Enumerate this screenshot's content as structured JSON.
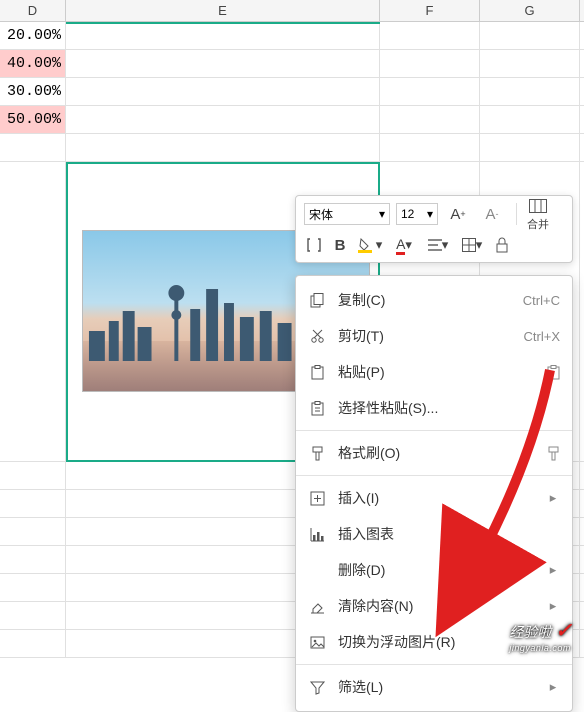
{
  "columns": {
    "d": "D",
    "e": "E",
    "f": "F",
    "g": "G"
  },
  "cells": {
    "d1": "20.00%",
    "d2": "40.00%",
    "d3": "30.00%",
    "d4": "50.00%"
  },
  "toolbar": {
    "font_name": "宋体",
    "font_size": "12",
    "increase_font": "A⁺",
    "decrease_font": "A⁻",
    "merge_label": "合并"
  },
  "menu": {
    "copy": {
      "label": "复制(C)",
      "shortcut": "Ctrl+C"
    },
    "cut": {
      "label": "剪切(T)",
      "shortcut": "Ctrl+X"
    },
    "paste": {
      "label": "粘贴(P)"
    },
    "paste_special": {
      "label": "选择性粘贴(S)..."
    },
    "format_painter": {
      "label": "格式刷(O)"
    },
    "insert": {
      "label": "插入(I)"
    },
    "insert_chart": {
      "label": "插入图表"
    },
    "delete": {
      "label": "删除(D)"
    },
    "clear": {
      "label": "清除内容(N)"
    },
    "float_image": {
      "label": "切换为浮动图片(R)"
    },
    "filter": {
      "label": "筛选(L)"
    }
  },
  "watermark": {
    "main": "经验啦",
    "sub": "jingyanla.com"
  }
}
